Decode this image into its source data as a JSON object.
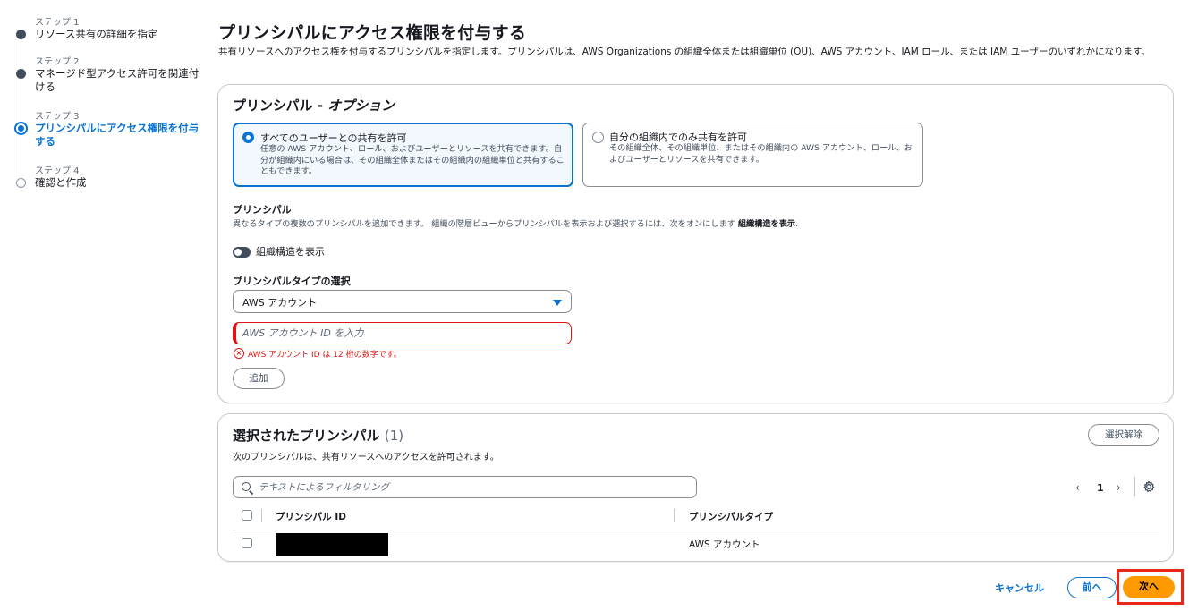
{
  "steps": [
    {
      "num": "ステップ 1",
      "title": "リソース共有の詳細を指定",
      "state": "done"
    },
    {
      "num": "ステップ 2",
      "title": "マネージド型アクセス許可を関連付ける",
      "state": "done"
    },
    {
      "num": "ステップ 3",
      "title": "プリンシパルにアクセス権限を付与する",
      "state": "current"
    },
    {
      "num": "ステップ 4",
      "title": "確認と作成",
      "state": "future"
    }
  ],
  "header": {
    "title": "プリンシパルにアクセス権限を付与する",
    "description": "共有リソースへのアクセス権を付与するプリンシパルを指定します。プリンシパルは、AWS Organizations の組織全体または組織単位 (OU)、AWS アカウント、IAM ロール、または IAM ユーザーのいずれかになります。"
  },
  "principals_panel": {
    "title": "プリンシパル - ",
    "title_optional": "オプション",
    "tiles": [
      {
        "label": "すべてのユーザーとの共有を許可",
        "description": "任意の AWS アカウント、ロール、およびユーザーとリソースを共有できます。自分が組織内にいる場合は、その組織全体またはその組織内の組織単位と共有することもできます。",
        "selected": true
      },
      {
        "label": "自分の組織内でのみ共有を許可",
        "description": "その組織全体、その組織単位、またはその組織内の AWS アカウント、ロール、およびユーザーとリソースを共有できます。",
        "selected": false
      }
    ],
    "principal_label": "プリンシパル",
    "principal_desc": "異なるタイプの複数のプリンシパルを追加できます。 組織の階層ビューからプリンシパルを表示および選択するには、次をオンにします ",
    "principal_desc_bold": "組織構造を表示",
    "principal_desc_end": ".",
    "toggle_label": "組織構造を表示",
    "type_label": "プリンシパルタイプの選択",
    "type_value": "AWS アカウント",
    "account_placeholder": "AWS アカウント ID を入力",
    "error_text": "AWS アカウント ID は 12 桁の数字です。",
    "add_label": "追加"
  },
  "selected_panel": {
    "title": "選択されたプリンシパル",
    "count": "(1)",
    "clear_label": "選択解除",
    "description": "次のプリンシパルは、共有リソースへのアクセスを許可されます。",
    "filter_placeholder": "テキストによるフィルタリング",
    "page": "1",
    "columns": [
      "プリンシパル ID",
      "プリンシパルタイプ"
    ],
    "rows": [
      {
        "id": "",
        "type": "AWS アカウント"
      }
    ]
  },
  "footer": {
    "cancel_label": "キャンセル",
    "prev_label": "前へ",
    "next_label": "次へ"
  },
  "colors": {
    "primary": "#0972d3",
    "error": "#d91515",
    "cta": "#ff9900",
    "highlight": "#e8271a"
  }
}
